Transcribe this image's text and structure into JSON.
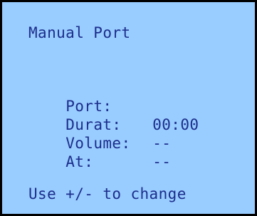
{
  "screen": {
    "title": "Manual Port",
    "fields": [
      {
        "label": "Port:",
        "value": ""
      },
      {
        "label": "Durat:",
        "value": "00:00"
      },
      {
        "label": "Volume:",
        "value": "--"
      },
      {
        "label": "At:",
        "value": "--"
      }
    ],
    "hint": "Use +/- to change"
  },
  "colors": {
    "background": "#99ccff",
    "text": "#1c2e8c",
    "border": "#000000"
  }
}
